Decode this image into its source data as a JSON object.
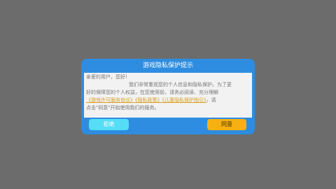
{
  "dialog": {
    "title": "游戏隐私保护提示",
    "greeting": "亲爱的用户，您好!",
    "line1": "我们非常重视您的个人信息和隐私保护。为了更",
    "line2": "好的保障您的个人权益，在您使用前，请务必阅读、充分理解",
    "link_service": "《游戏许可服务协议》",
    "link_privacy": "《隐私政策》",
    "link_child": "《儿童隐私保护指引》",
    "line3_tail": "，请",
    "line4": "点击\"同意\"开始使用我们的服务。",
    "reject_label": "拒绝",
    "agree_label": "同意"
  },
  "colors": {
    "backdrop": "#6c6c6c",
    "dialog_frame": "#2e8de0",
    "body_bg": "#f2f2f2",
    "link": "#d8a020",
    "reject_button": "#55ddf5",
    "agree_button": "#f7b012"
  }
}
